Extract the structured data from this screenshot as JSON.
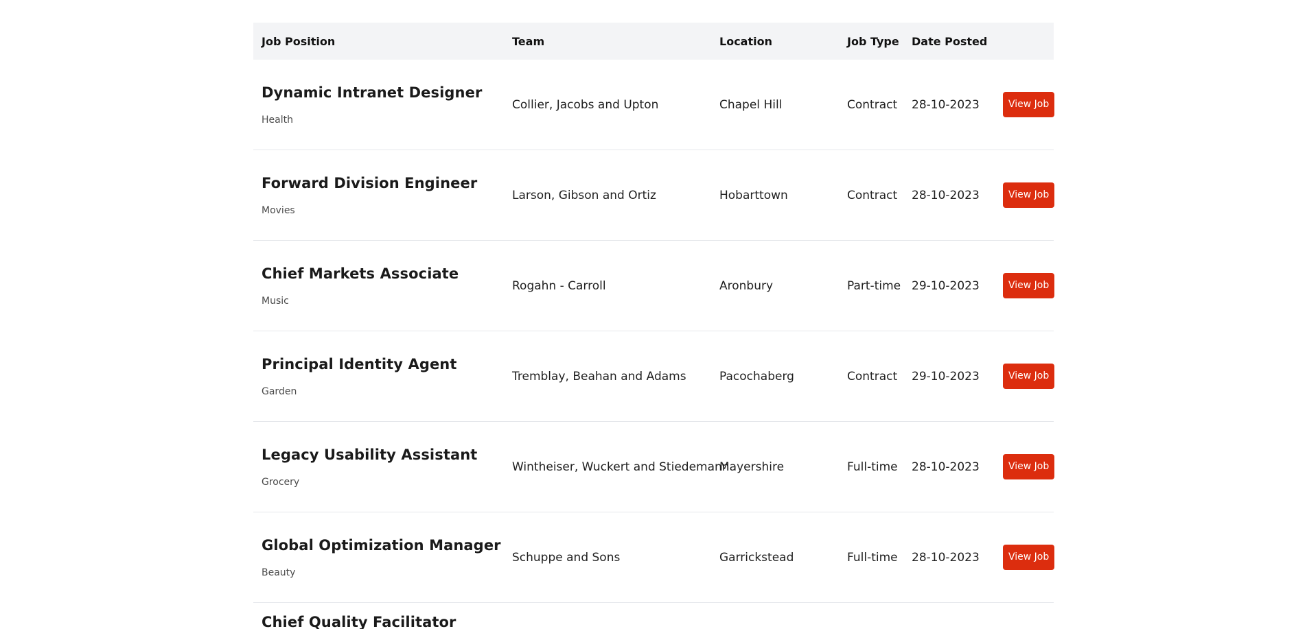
{
  "table": {
    "headers": {
      "position": "Job Position",
      "team": "Team",
      "location": "Location",
      "type": "Job Type",
      "date": "Date Posted"
    },
    "button_label": "View Job",
    "rows": [
      {
        "title": "Dynamic Intranet Designer",
        "category": "Health",
        "team": "Collier, Jacobs and Upton",
        "location": "Chapel Hill",
        "type": "Contract",
        "date": "28-10-2023"
      },
      {
        "title": "Forward Division Engineer",
        "category": "Movies",
        "team": "Larson, Gibson and Ortiz",
        "location": "Hobarttown",
        "type": "Contract",
        "date": "28-10-2023"
      },
      {
        "title": "Chief Markets Associate",
        "category": "Music",
        "team": "Rogahn - Carroll",
        "location": "Aronbury",
        "type": "Part-time",
        "date": "29-10-2023"
      },
      {
        "title": "Principal Identity Agent",
        "category": "Garden",
        "team": "Tremblay, Beahan and Adams",
        "location": "Pacochaberg",
        "type": "Contract",
        "date": "29-10-2023"
      },
      {
        "title": "Legacy Usability Assistant",
        "category": "Grocery",
        "team": "Wintheiser, Wuckert and Stiedemann",
        "location": "Mayershire",
        "type": "Full-time",
        "date": "28-10-2023"
      },
      {
        "title": "Global Optimization Manager",
        "category": "Beauty",
        "team": "Schuppe and Sons",
        "location": "Garrickstead",
        "type": "Full-time",
        "date": "28-10-2023"
      }
    ],
    "partial_row": {
      "title": "Chief Quality Facilitator"
    }
  },
  "colors": {
    "header_bg": "#f3f4f6",
    "button_bg": "#dc2d0e",
    "button_text": "#ffffff",
    "row_divider": "#e5e7eb"
  }
}
